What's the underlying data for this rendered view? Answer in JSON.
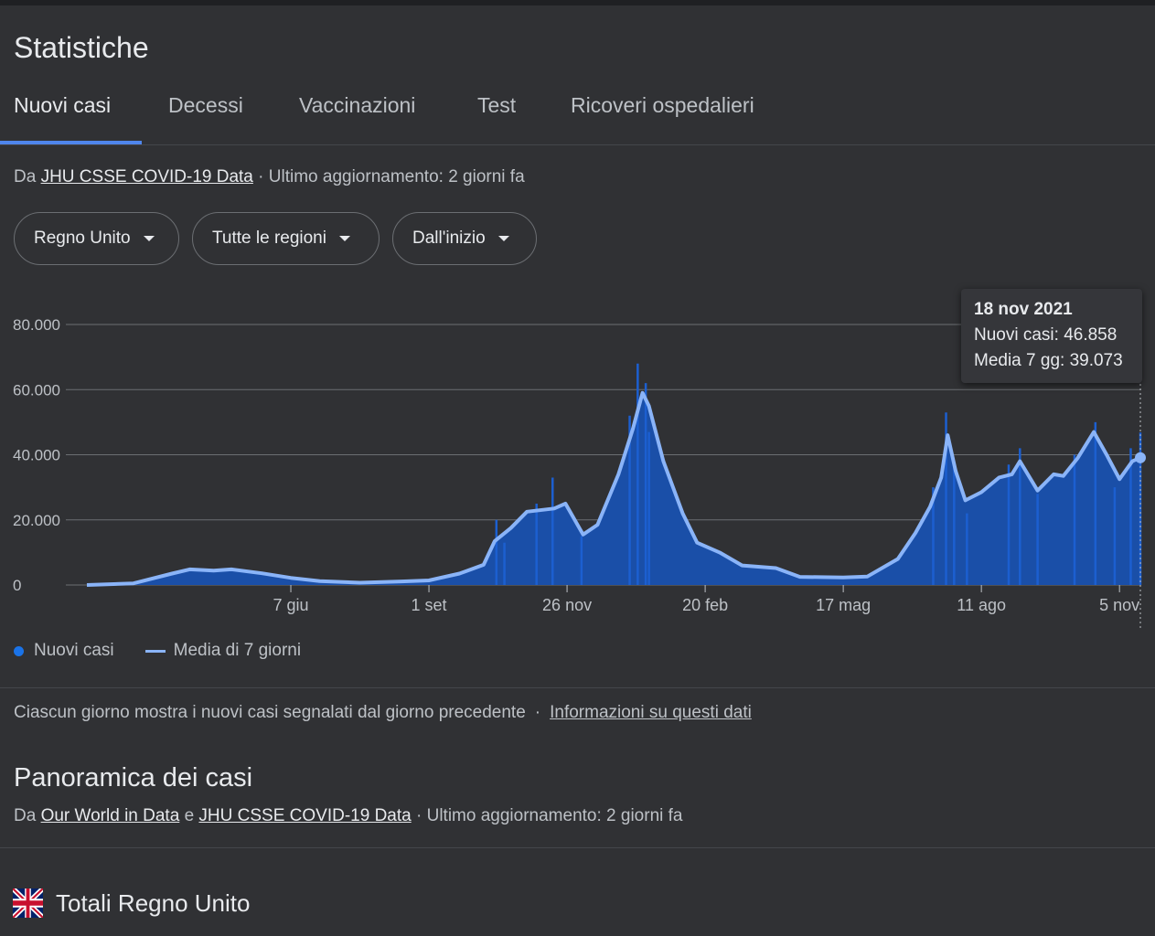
{
  "title": "Statistiche",
  "tabs": [
    {
      "label": "Nuovi casi",
      "active": true
    },
    {
      "label": "Decessi"
    },
    {
      "label": "Vaccinazioni"
    },
    {
      "label": "Test"
    },
    {
      "label": "Ricoveri ospedalieri"
    }
  ],
  "source": {
    "prefix": "Da",
    "link": "JHU CSSE COVID-19 Data",
    "updated": "· Ultimo aggiornamento: 2 giorni fa"
  },
  "filters": [
    {
      "label": "Regno Unito"
    },
    {
      "label": "Tutte le regioni"
    },
    {
      "label": "Dall'inizio"
    }
  ],
  "tooltip": {
    "date": "18 nov 2021",
    "cases": "Nuovi casi: 46.858",
    "avg": "Media 7 gg: 39.073"
  },
  "legend": {
    "cases": "Nuovi casi",
    "avg": "Media di 7 giorni"
  },
  "note": {
    "text": "Ciascun giorno mostra i nuovi casi segnalati dal giorno precedente",
    "sep": "·",
    "link": "Informazioni su questi dati"
  },
  "overview": {
    "title": "Panoramica dei casi",
    "prefix": "Da",
    "link1": "Our World in Data",
    "conj": "e",
    "link2": "JHU CSSE COVID-19 Data",
    "updated": "· Ultimo aggiornamento: 2 giorni fa"
  },
  "totals": {
    "label": "Totali Regno Unito",
    "flag_icon": "uk-flag-icon"
  },
  "colors": {
    "background": "#303134",
    "area": "#1a4fa8",
    "line": "#8ab4f8",
    "accent": "#1a73e8"
  },
  "chart_data": {
    "type": "area",
    "title": "",
    "xlabel": "",
    "ylabel": "",
    "ylim": [
      0,
      80000
    ],
    "yticks": [
      {
        "label": "80.000",
        "value": 80000
      },
      {
        "label": "60.000",
        "value": 60000
      },
      {
        "label": "40.000",
        "value": 40000
      },
      {
        "label": "20.000",
        "value": 20000
      },
      {
        "label": "0",
        "value": 0
      }
    ],
    "xticks": [
      {
        "label": "7 giu",
        "date": "2020-06-07"
      },
      {
        "label": "1 set",
        "date": "2020-09-01"
      },
      {
        "label": "26 nov",
        "date": "2020-11-26"
      },
      {
        "label": "20 feb",
        "date": "2021-02-20"
      },
      {
        "label": "17 mag",
        "date": "2021-05-17"
      },
      {
        "label": "11 ago",
        "date": "2021-08-11"
      },
      {
        "label": "5 nov",
        "date": "2021-11-05"
      }
    ],
    "grid": true,
    "legend_position": "bottom-left",
    "series": [
      {
        "name": "Media di 7 giorni",
        "points": [
          [
            "2020-02-01",
            0
          ],
          [
            "2020-03-01",
            500
          ],
          [
            "2020-03-25",
            3500
          ],
          [
            "2020-04-05",
            4800
          ],
          [
            "2020-04-20",
            4400
          ],
          [
            "2020-05-01",
            4800
          ],
          [
            "2020-05-20",
            3600
          ],
          [
            "2020-06-07",
            2200
          ],
          [
            "2020-06-25",
            1200
          ],
          [
            "2020-07-20",
            700
          ],
          [
            "2020-08-15",
            1100
          ],
          [
            "2020-09-01",
            1400
          ],
          [
            "2020-09-20",
            3500
          ],
          [
            "2020-10-05",
            6200
          ],
          [
            "2020-10-12",
            13500
          ],
          [
            "2020-10-22",
            17500
          ],
          [
            "2020-11-01",
            22500
          ],
          [
            "2020-11-18",
            23500
          ],
          [
            "2020-11-25",
            25000
          ],
          [
            "2020-12-06",
            15500
          ],
          [
            "2020-12-15",
            18500
          ],
          [
            "2020-12-28",
            34000
          ],
          [
            "2021-01-06",
            48000
          ],
          [
            "2021-01-12",
            59000
          ],
          [
            "2021-01-16",
            55000
          ],
          [
            "2021-01-25",
            38000
          ],
          [
            "2021-02-06",
            22000
          ],
          [
            "2021-02-15",
            13000
          ],
          [
            "2021-03-01",
            10000
          ],
          [
            "2021-03-15",
            6000
          ],
          [
            "2021-04-05",
            5200
          ],
          [
            "2021-04-20",
            2500
          ],
          [
            "2021-05-17",
            2300
          ],
          [
            "2021-06-01",
            2600
          ],
          [
            "2021-06-20",
            8000
          ],
          [
            "2021-07-01",
            16000
          ],
          [
            "2021-07-10",
            24000
          ],
          [
            "2021-07-17",
            33000
          ],
          [
            "2021-07-21",
            46000
          ],
          [
            "2021-07-26",
            35000
          ],
          [
            "2021-08-01",
            26000
          ],
          [
            "2021-08-11",
            28500
          ],
          [
            "2021-08-22",
            33000
          ],
          [
            "2021-08-30",
            34000
          ],
          [
            "2021-09-04",
            38000
          ],
          [
            "2021-09-15",
            29000
          ],
          [
            "2021-09-25",
            34000
          ],
          [
            "2021-10-01",
            33500
          ],
          [
            "2021-10-10",
            39000
          ],
          [
            "2021-10-20",
            47000
          ],
          [
            "2021-10-28",
            40000
          ],
          [
            "2021-11-05",
            32500
          ],
          [
            "2021-11-13",
            38000
          ],
          [
            "2021-11-18",
            39073
          ]
        ]
      },
      {
        "name": "Nuovi casi",
        "points": [
          [
            "2020-10-13",
            20000
          ],
          [
            "2020-10-18",
            13000
          ],
          [
            "2020-11-07",
            25000
          ],
          [
            "2020-11-17",
            33000
          ],
          [
            "2020-12-05",
            15000
          ],
          [
            "2021-01-04",
            52000
          ],
          [
            "2021-01-09",
            68000
          ],
          [
            "2021-01-14",
            62000
          ],
          [
            "2021-01-16",
            47000
          ],
          [
            "2021-07-12",
            30000
          ],
          [
            "2021-07-20",
            53000
          ],
          [
            "2021-07-25",
            38000
          ],
          [
            "2021-08-02",
            22000
          ],
          [
            "2021-08-28",
            37000
          ],
          [
            "2021-09-04",
            42000
          ],
          [
            "2021-09-15",
            28000
          ],
          [
            "2021-10-08",
            40000
          ],
          [
            "2021-10-21",
            50000
          ],
          [
            "2021-11-02",
            30000
          ],
          [
            "2021-11-12",
            42000
          ],
          [
            "2021-11-18",
            46858
          ]
        ]
      }
    ]
  }
}
